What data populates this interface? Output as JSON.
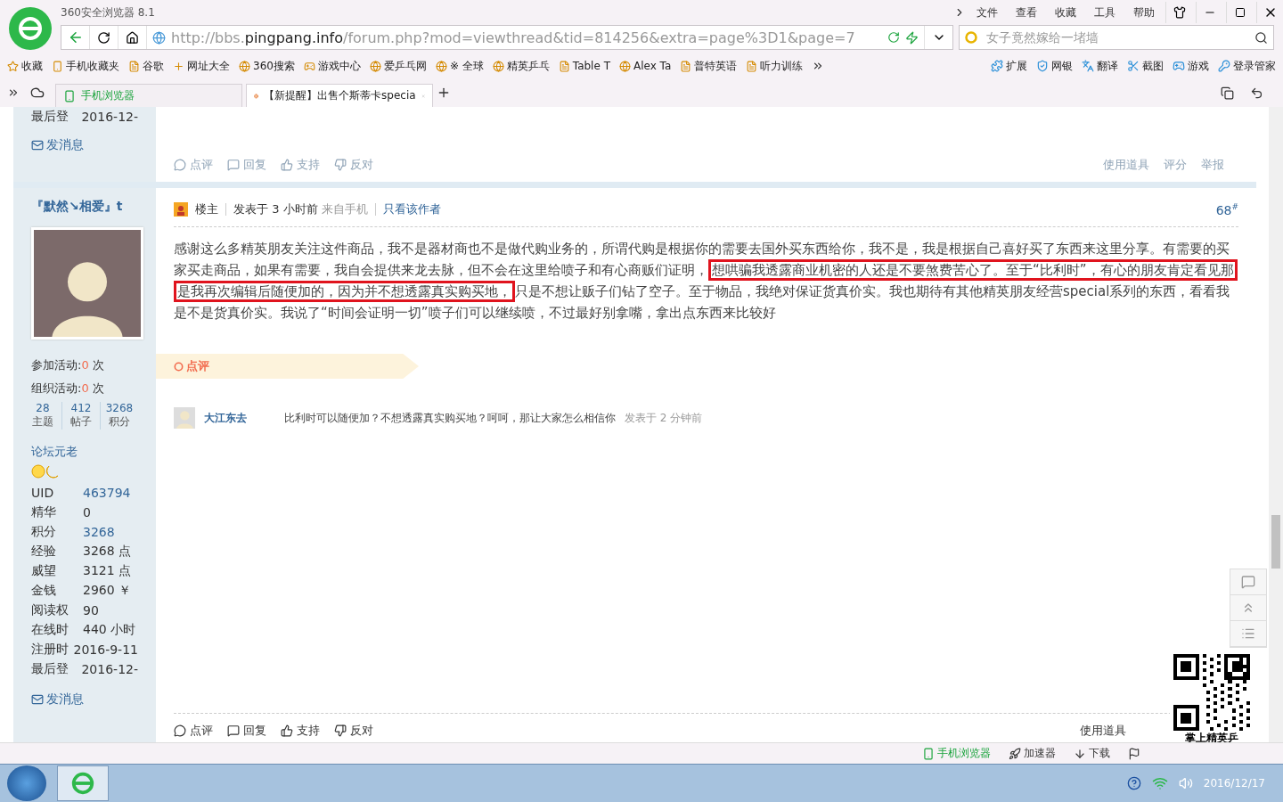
{
  "window": {
    "title": "360安全浏览器 8.1",
    "menu": [
      "文件",
      "查看",
      "收藏",
      "工具",
      "帮助"
    ]
  },
  "address_bar": {
    "url_scheme": "http://bbs.",
    "url_domain": "pingpang.info",
    "url_path": "/forum.php?mod=viewthread&tid=814256&extra=page%3D1&page=7"
  },
  "search": {
    "placeholder": "女子竟然嫁给一堵墙"
  },
  "bookmarks": [
    "收藏",
    "手机收藏夹",
    "谷歌",
    "网址大全",
    "360搜索",
    "游戏中心",
    "爱乒乓网",
    "※ 全球",
    "精英乒乓",
    "Table T",
    "Alex Ta",
    "普特英语",
    "听力训练"
  ],
  "extensions": [
    "扩展",
    "网银",
    "翻译",
    "截图",
    "游戏",
    "登录管家"
  ],
  "tabs": [
    {
      "label": "手机浏览器",
      "selected": false
    },
    {
      "label": "【新提醒】出售个斯蒂卡specia",
      "selected": true
    }
  ],
  "previous_post": {
    "sidebar_rows": [
      {
        "label": "最后登",
        "value": "2016-12-"
      }
    ],
    "send_message": "发消息",
    "actions": [
      "点评",
      "回复",
      "支持",
      "反对"
    ],
    "tools": [
      "使用道具",
      "评分",
      "举报"
    ]
  },
  "post": {
    "author": {
      "name": "『默然↘相爱』t",
      "activity": [
        {
          "label": "参加活动:",
          "count": "0",
          "unit": "次"
        },
        {
          "label": "组织活动:",
          "count": "0",
          "unit": "次"
        }
      ],
      "stats": [
        {
          "value": "28",
          "label": "主题"
        },
        {
          "value": "412",
          "label": "帖子"
        },
        {
          "value": "3268",
          "label": "积分"
        }
      ],
      "rank": "论坛元老",
      "profile": [
        {
          "label": "UID",
          "value": "463794",
          "link": true
        },
        {
          "label": "精华",
          "value": "0",
          "link": false
        },
        {
          "label": "积分",
          "value": "3268",
          "link": true
        },
        {
          "label": "经验",
          "value": "3268 点",
          "link": false
        },
        {
          "label": "威望",
          "value": "3121 点",
          "link": false
        },
        {
          "label": "金钱",
          "value": "2960 ￥",
          "link": false
        },
        {
          "label": "阅读权",
          "value": "90",
          "link": false
        },
        {
          "label": "在线时",
          "value": "440 小时",
          "link": false
        },
        {
          "label": "注册时",
          "value": "2016-9-11",
          "link": false
        },
        {
          "label": "最后登",
          "value": "2016-12-",
          "link": false
        }
      ],
      "send_message": "发消息"
    },
    "header": {
      "role": "楼主",
      "posted": "发表于 3 小时前",
      "source": "来自手机",
      "author_only": "只看该作者",
      "floor": "68$^{#}$"
    },
    "body": [
      {
        "text": "感谢这么多精英朋友关注这件商品，我不是器材商也不是做代购业务的，所谓代购是根据你的需要去国外买东西给你，我不是，我是根据自己喜好买了东西来这里分享。有需要的买家买走商品，如果有需要，我自会提供来龙去脉，但不会在这里给喷子和有心商贩们证明，",
        "highlighted": false
      },
      {
        "text": "想哄骗我透露商业机密的人还是不要煞费苦心了。至于“比利时”，有心的朋友肯定看见那是我再次编辑后随便加的，因为并不想透露真实购买地，",
        "highlighted": true
      },
      {
        "text": "只是不想让贩子们钻了空子。至于物品，我绝对保证货真价实。我也期待有其他精英朋友经营special系列的东西，看看我是不是货真价实。我说了“时间会证明一切”喷子们可以继续喷，不过最好别拿嘴，拿出点东西来比较好",
        "highlighted": false
      }
    ],
    "comment_section": {
      "label": "点评",
      "comments": [
        {
          "author": "大江东去",
          "text": "比利时可以随便加？不想透露真实购买地？呵呵，那让大家怎么相信你",
          "time": "发表于 2 分钟前"
        }
      ]
    },
    "actions": [
      "点评",
      "回复",
      "支持",
      "反对"
    ],
    "tools": [
      "使用道具"
    ]
  },
  "qr": {
    "caption": "掌上精英乒"
  },
  "status_bar": [
    "手机浏览器",
    "加速器",
    "下载"
  ],
  "taskbar": {
    "date": "2016/12/17"
  }
}
